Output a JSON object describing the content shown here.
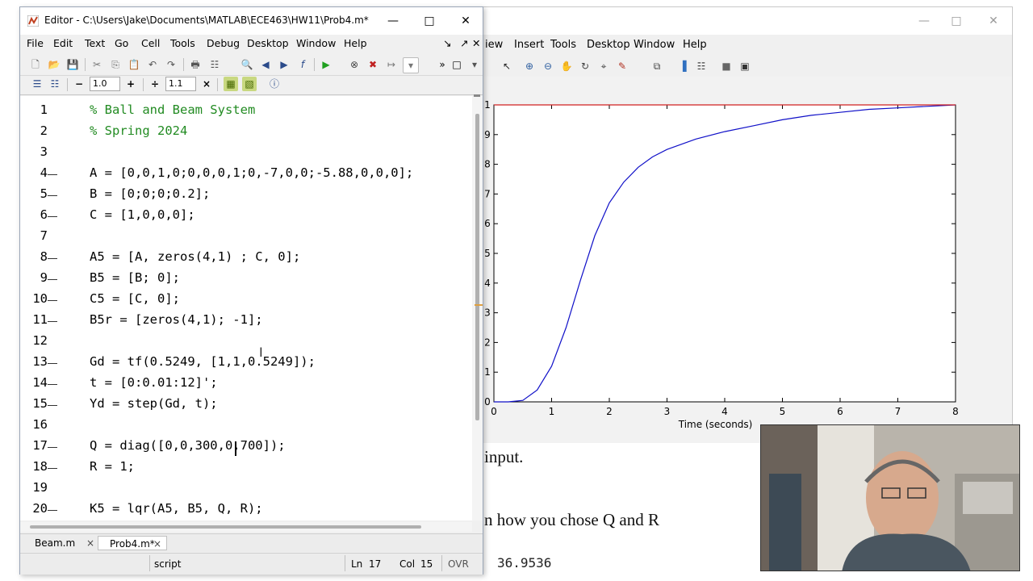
{
  "document": {
    "line1": "input.",
    "line2": "n how you chose Q and R",
    "value": "36.9536"
  },
  "figure": {
    "menu": [
      "iew",
      "Insert",
      "Tools",
      "Desktop",
      "Window",
      "Help"
    ],
    "chart_data": {
      "type": "line",
      "x": [
        0,
        0.25,
        0.5,
        0.75,
        1,
        1.25,
        1.5,
        1.75,
        2,
        2.25,
        2.5,
        2.75,
        3,
        3.5,
        4,
        4.5,
        5,
        5.5,
        6,
        6.5,
        7,
        7.5,
        8
      ],
      "series": [
        {
          "values": [
            0,
            0.0,
            0.005,
            0.04,
            0.12,
            0.25,
            0.41,
            0.56,
            0.67,
            0.74,
            0.79,
            0.825,
            0.85,
            0.885,
            0.91,
            0.93,
            0.95,
            0.965,
            0.975,
            0.985,
            0.99,
            0.995,
            1.0
          ],
          "color": "#1010c8"
        },
        {
          "values": [
            1,
            1,
            1,
            1,
            1,
            1,
            1,
            1,
            1,
            1,
            1,
            1,
            1,
            1,
            1,
            1,
            1,
            1,
            1,
            1,
            1,
            1,
            1
          ],
          "color": "#d02020"
        }
      ],
      "xlim": [
        0,
        8
      ],
      "ylim": [
        0,
        1
      ],
      "xticks": [
        "0",
        "1",
        "2",
        "3",
        "4",
        "5",
        "6",
        "7",
        "8"
      ],
      "yticks": [
        "0",
        ".1",
        ".2",
        ".3",
        ".4",
        ".5",
        ".6",
        ".7",
        ".8",
        ".9",
        "1"
      ],
      "xlabel": "Time (seconds)"
    }
  },
  "editor": {
    "title": "Editor - C:\\Users\\Jake\\Documents\\MATLAB\\ECE463\\HW11\\Prob4.m*",
    "menu": [
      "File",
      "Edit",
      "Text",
      "Go",
      "Cell",
      "Tools",
      "Debug",
      "Desktop",
      "Window",
      "Help"
    ],
    "cell_minus": "−",
    "cell_value1": "1.0",
    "cell_plus": "+",
    "cell_divide": "÷",
    "cell_value2": "1.1",
    "cell_times": "×",
    "lines": [
      {
        "n": "1",
        "text": "% Ball and Beam System",
        "comment": true,
        "dash": false
      },
      {
        "n": "2",
        "text": "% Spring 2024",
        "comment": true,
        "dash": false
      },
      {
        "n": "3",
        "text": "",
        "comment": false,
        "dash": false
      },
      {
        "n": "4",
        "text": "A = [0,0,1,0;0,0,0,1;0,-7,0,0;-5.88,0,0,0];",
        "comment": false,
        "dash": true
      },
      {
        "n": "5",
        "text": "B = [0;0;0;0.2];",
        "comment": false,
        "dash": true
      },
      {
        "n": "6",
        "text": "C = [1,0,0,0];",
        "comment": false,
        "dash": true
      },
      {
        "n": "7",
        "text": "",
        "comment": false,
        "dash": false
      },
      {
        "n": "8",
        "text": "A5 = [A, zeros(4,1) ; C, 0];",
        "comment": false,
        "dash": true
      },
      {
        "n": "9",
        "text": "B5 = [B; 0];",
        "comment": false,
        "dash": true
      },
      {
        "n": "10",
        "text": "C5 = [C, 0];",
        "comment": false,
        "dash": true
      },
      {
        "n": "11",
        "text": "B5r = [zeros(4,1); -1];",
        "comment": false,
        "dash": true
      },
      {
        "n": "12",
        "text": "",
        "comment": false,
        "dash": false
      },
      {
        "n": "13",
        "text": "Gd = tf(0.5249, [1,1,0.5249]);",
        "comment": false,
        "dash": true
      },
      {
        "n": "14",
        "text": "t = [0:0.01:12]';",
        "comment": false,
        "dash": true
      },
      {
        "n": "15",
        "text": "Yd = step(Gd, t);",
        "comment": false,
        "dash": true
      },
      {
        "n": "16",
        "text": "",
        "comment": false,
        "dash": false
      },
      {
        "n": "17",
        "text": "Q = diag([0,0,300,0,700]);",
        "comment": false,
        "dash": true
      },
      {
        "n": "18",
        "text": "R = 1;",
        "comment": false,
        "dash": true
      },
      {
        "n": "19",
        "text": "",
        "comment": false,
        "dash": false
      },
      {
        "n": "20",
        "text": "K5 = lqr(A5, B5, Q, R);",
        "comment": false,
        "dash": true
      }
    ],
    "tabs": [
      {
        "label": "Beam.m",
        "active": false
      },
      {
        "label": "Prob4.m*",
        "active": true
      }
    ],
    "tab_close": "×",
    "status": {
      "mode": "script",
      "ln_label": "Ln",
      "ln_value": "17",
      "col_label": "Col",
      "col_value": "15",
      "ovr": "OVR"
    }
  }
}
